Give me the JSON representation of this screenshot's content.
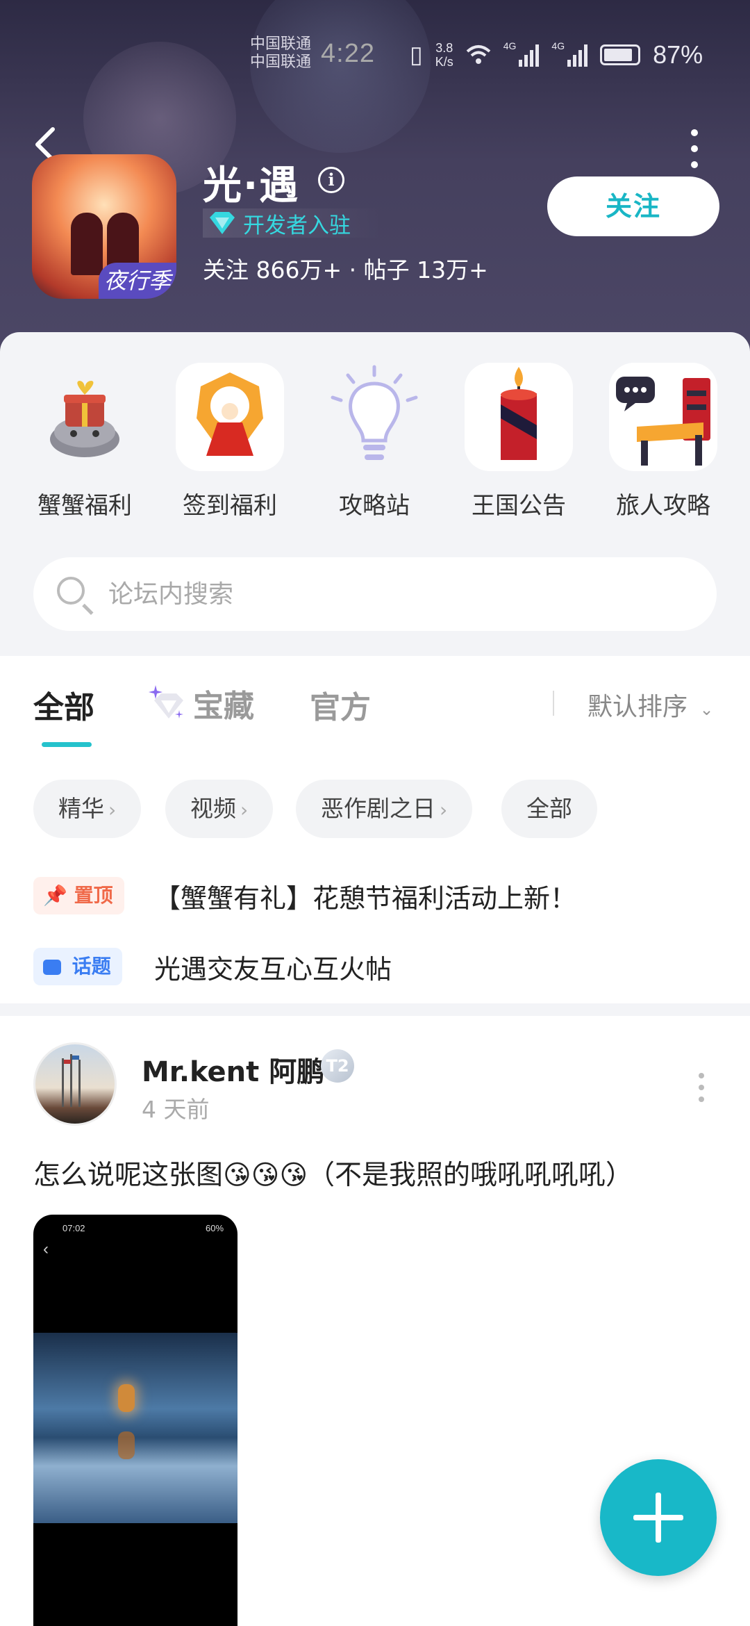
{
  "status_bar": {
    "carrier1": "中国联通",
    "carrier2": "中国联通",
    "time": "4:22",
    "speed_value": "3.8",
    "speed_unit": "K/s",
    "network1": "4G",
    "network2": "4G",
    "battery": "87%"
  },
  "header": {
    "title": "光·遇",
    "developer_label": "开发者入驻",
    "stats": "关注 866万+ · 帖子 13万+",
    "follow_label": "关注",
    "icon_badge": "夜行季"
  },
  "shortcuts": [
    {
      "label": "蟹蟹福利",
      "icon": "gift-crab-icon"
    },
    {
      "label": "签到福利",
      "icon": "sign-in-icon"
    },
    {
      "label": "攻略站",
      "icon": "lightbulb-icon"
    },
    {
      "label": "王国公告",
      "icon": "candle-icon"
    },
    {
      "label": "旅人攻略",
      "icon": "chair-icon"
    }
  ],
  "search": {
    "placeholder": "论坛内搜索"
  },
  "tabs": {
    "all": "全部",
    "treasure": "宝藏",
    "official": "官方",
    "sort": "默认排序"
  },
  "chips": [
    "精华",
    "视频",
    "恶作剧之日",
    "全部"
  ],
  "notices": [
    {
      "tag": "置顶",
      "text": "【蟹蟹有礼】花憩节福利活动上新！"
    },
    {
      "tag": "话题",
      "text": "光遇交友互心互火帖"
    }
  ],
  "post": {
    "username": "Mr.kent 阿鹏",
    "level": "T2",
    "time": "4 天前",
    "text": "怎么说呢这张图😘😘😘（不是我照的哦吼吼吼吼）",
    "image_status_time": "07:02",
    "image_battery": "60%"
  },
  "colors": {
    "accent": "#19b6c5",
    "pin": "#f06a4a",
    "topic": "#3a7df2"
  }
}
